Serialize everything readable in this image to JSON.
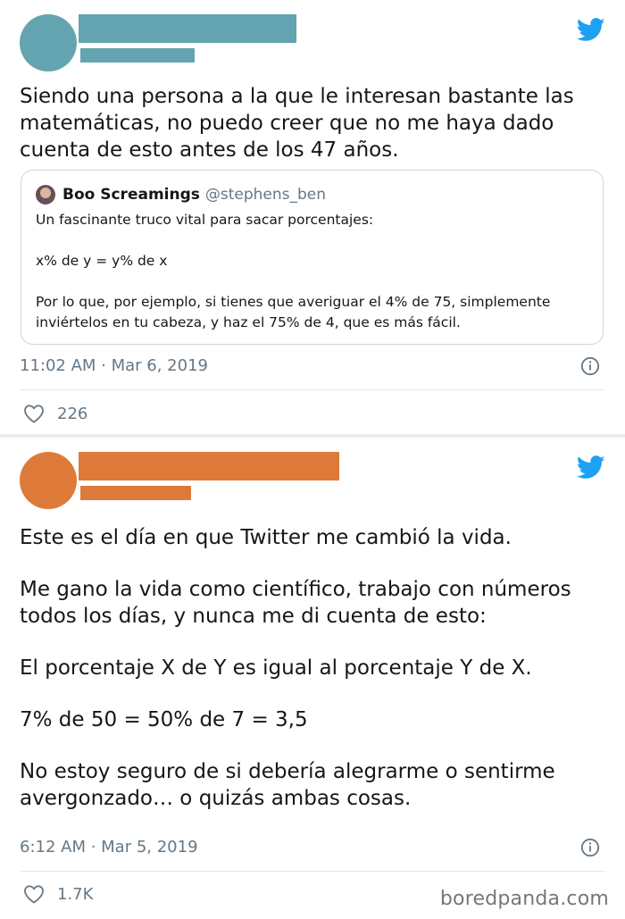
{
  "colors": {
    "tweet1_avatar": "#63a4b0",
    "tweet1_redaction": "#63a4b0",
    "tweet2_avatar": "#de7a39",
    "tweet2_redaction": "#de7a39",
    "twitter_blue": "#1da1f2",
    "muted_gray": "#657786"
  },
  "tweet1": {
    "text_lines": [
      "Siendo una persona a la que le interesan bastante las",
      "matemáticas, no puedo creer que no me haya dado",
      "cuenta de esto antes de los 47 años."
    ],
    "quote": {
      "name": "Boo Screamings",
      "handle": "@stephens_ben",
      "line1": "Un fascinante truco vital para sacar porcentajes:",
      "line2": "x% de y = y% de x",
      "line3a": "Por lo que, por ejemplo, si tienes que averiguar el 4% de 75, simplemente",
      "line3b": "inviértelos en tu cabeza, y haz el 75% de 4, que es más fácil."
    },
    "timestamp": "11:02 AM · Mar 6, 2019",
    "likes": "226"
  },
  "tweet2": {
    "p1": "Este es el día en que Twitter me cambió la vida.",
    "p2a": "Me gano la vida como científico, trabajo con números",
    "p2b": "todos los días, y nunca me di cuenta de esto:",
    "p3": "El porcentaje X de Y es igual al porcentaje Y de X.",
    "p4": "7% de 50 = 50% de 7 = 3,5",
    "p5a": "No estoy seguro de si debería alegrarme o sentirme",
    "p5b": "avergonzado… o quizás ambas cosas.",
    "timestamp": "6:12 AM · Mar 5, 2019",
    "likes": "1.7K"
  },
  "watermark": "boredpanda.com",
  "icons": {
    "brand": "twitter-bird-icon",
    "info": "info-icon",
    "like": "heart-icon"
  }
}
